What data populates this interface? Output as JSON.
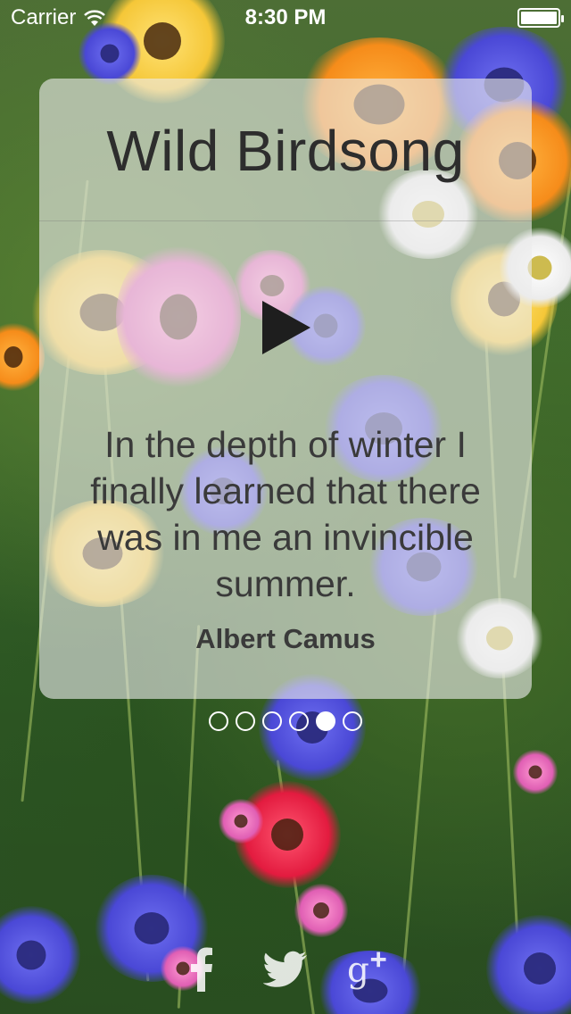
{
  "status_bar": {
    "carrier": "Carrier",
    "time": "8:30 PM"
  },
  "card": {
    "title": "Wild Birdsong",
    "quote": "In the depth of winter I finally learned that there was in me an invincible summer.",
    "author": "Albert Camus"
  },
  "page_indicator": {
    "count": 6,
    "active_index": 4
  },
  "social": [
    {
      "icon": "facebook-icon"
    },
    {
      "icon": "twitter-icon"
    },
    {
      "icon": "google-plus-icon"
    }
  ],
  "colors": {
    "card_background": "rgba(235,235,235,0.62)",
    "text": "#3a3a3a",
    "title_text": "#2d2d2d",
    "indicator": "#ffffff"
  }
}
